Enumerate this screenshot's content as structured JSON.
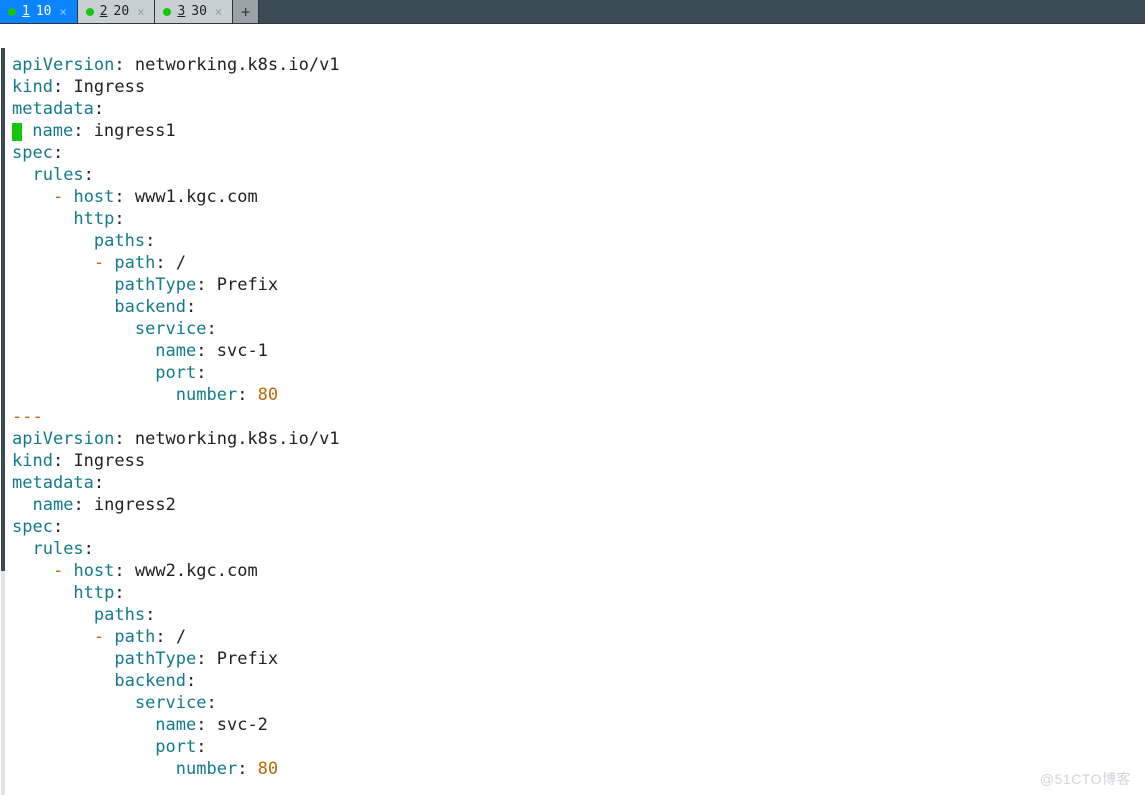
{
  "tabs": [
    {
      "num": "1",
      "label": "10",
      "active": true
    },
    {
      "num": "2",
      "label": "20",
      "active": false
    },
    {
      "num": "3",
      "label": "30",
      "active": false
    }
  ],
  "newtab_glyph": "+",
  "close_glyph": "×",
  "watermark": "@51CTO博客",
  "doc1": {
    "apiVersion_k": "apiVersion",
    "apiVersion_v": "networking.k8s.io/v1",
    "kind_k": "kind",
    "kind_v": "Ingress",
    "metadata_k": "metadata",
    "name_k": "name",
    "name_v": "ingress1",
    "spec_k": "spec",
    "rules_k": "rules",
    "host_k": "host",
    "host_v": "www1.kgc.com",
    "http_k": "http",
    "paths_k": "paths",
    "path_k": "path",
    "path_v": "/",
    "pathType_k": "pathType",
    "pathType_v": "Prefix",
    "backend_k": "backend",
    "service_k": "service",
    "svc_name_k": "name",
    "svc_name_v": "svc-1",
    "port_k": "port",
    "number_k": "number",
    "number_v": "80"
  },
  "separator": "---",
  "doc2": {
    "apiVersion_k": "apiVersion",
    "apiVersion_v": "networking.k8s.io/v1",
    "kind_k": "kind",
    "kind_v": "Ingress",
    "metadata_k": "metadata",
    "name_k": "name",
    "name_v": "ingress2",
    "spec_k": "spec",
    "rules_k": "rules",
    "host_k": "host",
    "host_v": "www2.kgc.com",
    "http_k": "http",
    "paths_k": "paths",
    "path_k": "path",
    "path_v": "/",
    "pathType_k": "pathType",
    "pathType_v": "Prefix",
    "backend_k": "backend",
    "service_k": "service",
    "svc_name_k": "name",
    "svc_name_v": "svc-2",
    "port_k": "port",
    "number_k": "number",
    "number_v": "80"
  }
}
